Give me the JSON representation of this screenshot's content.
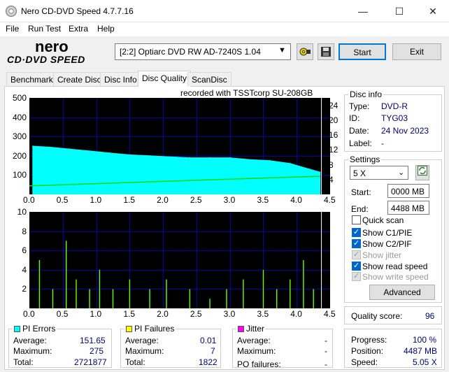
{
  "window": {
    "title": "Nero CD-DVD Speed 4.7.7.16",
    "min_symbol": "—",
    "max_symbol": "☐",
    "close_symbol": "✕"
  },
  "menu": [
    "File",
    "Run Test",
    "Extra",
    "Help"
  ],
  "toolbar": {
    "drive": "[2:2]  Optiarc DVD RW AD-7240S 1.04",
    "start_label": "Start",
    "exit_label": "Exit"
  },
  "logo": {
    "nero": "nero",
    "sub": "CD·DVD SPEED"
  },
  "tabs": [
    "Benchmark",
    "Create Disc",
    "Disc Info",
    "Disc Quality",
    "ScanDisc"
  ],
  "active_tab": "Disc Quality",
  "chart_top": {
    "recorded_with": "recorded with TSSTcorp SU-208GB",
    "y_left_ticks": [
      "500",
      "400",
      "300",
      "200",
      "100"
    ],
    "y_right_ticks": [
      "24",
      "20",
      "16",
      "12",
      "8",
      "4"
    ],
    "x_ticks": [
      "0.0",
      "0.5",
      "1.0",
      "1.5",
      "2.0",
      "2.5",
      "3.0",
      "3.5",
      "4.0",
      "4.5"
    ]
  },
  "chart_bottom": {
    "y_ticks": [
      "10",
      "8",
      "6",
      "4",
      "2"
    ],
    "x_ticks": [
      "0.0",
      "0.5",
      "1.0",
      "1.5",
      "2.0",
      "2.5",
      "3.0",
      "3.5",
      "4.0",
      "4.5"
    ]
  },
  "chart_data": [
    {
      "type": "area",
      "title": "recorded with TSSTcorp SU-208GB",
      "xlim": [
        0,
        4.5
      ],
      "ylim": [
        0,
        500
      ],
      "y2lim": [
        0,
        26
      ],
      "series": [
        {
          "name": "PI Errors",
          "color": "#00ffff",
          "x": [
            0.05,
            0.3,
            0.6,
            0.9,
            1.2,
            1.5,
            1.8,
            2.1,
            2.4,
            2.7,
            3.0,
            3.3,
            3.6,
            3.9,
            4.2,
            4.35
          ],
          "values": [
            250,
            245,
            235,
            225,
            215,
            205,
            200,
            195,
            190,
            190,
            190,
            180,
            175,
            160,
            130,
            115
          ]
        },
        {
          "name": "Read speed",
          "color": "#00dd00",
          "axis": "right",
          "x": [
            0.0,
            0.5,
            1.0,
            1.5,
            2.0,
            2.5,
            3.0,
            3.5,
            4.0,
            4.35
          ],
          "values": [
            2.3,
            2.6,
            2.9,
            3.2,
            3.5,
            3.8,
            4.1,
            4.4,
            4.7,
            4.9
          ]
        }
      ]
    },
    {
      "type": "bar",
      "xlim": [
        0,
        4.5
      ],
      "ylim": [
        0,
        10
      ],
      "series": [
        {
          "name": "PI Failures",
          "color": "#66ff00",
          "x": [
            0.15,
            0.35,
            0.55,
            0.7,
            0.9,
            1.05,
            1.25,
            1.5,
            1.8,
            2.05,
            2.4,
            2.7,
            2.95,
            3.2,
            3.5,
            3.7,
            3.9,
            4.1,
            4.25
          ],
          "values": [
            5,
            2,
            7,
            3,
            2,
            4,
            2,
            3,
            2,
            3,
            2,
            1,
            2,
            3,
            4,
            2,
            3,
            5,
            2
          ]
        }
      ]
    }
  ],
  "disc_info": {
    "title": "Disc info",
    "type_label": "Type:",
    "type_value": "DVD-R",
    "id_label": "ID:",
    "id_value": "TYG03",
    "date_label": "Date:",
    "date_value": "24 Nov 2023",
    "label_label": "Label:",
    "label_value": "-"
  },
  "settings": {
    "title": "Settings",
    "speed": "5 X",
    "start_label": "Start:",
    "start_value": "0000 MB",
    "end_label": "End:",
    "end_value": "4488 MB",
    "quick_scan": "Quick scan",
    "show_c1pie": "Show C1/PIE",
    "show_c2pif": "Show C2/PIF",
    "show_jitter": "Show jitter",
    "show_read_speed": "Show read speed",
    "show_write_speed": "Show write speed",
    "advanced": "Advanced"
  },
  "quality": {
    "label": "Quality score:",
    "value": "96"
  },
  "progress": {
    "progress_label": "Progress:",
    "progress_value": "100 %",
    "position_label": "Position:",
    "position_value": "4487 MB",
    "speed_label": "Speed:",
    "speed_value": "5.05 X"
  },
  "pi_errors": {
    "title": "PI Errors",
    "color": "#00ffff",
    "avg_label": "Average:",
    "avg": "151.65",
    "max_label": "Maximum:",
    "max": "275",
    "total_label": "Total:",
    "total": "2721877"
  },
  "pi_failures": {
    "title": "PI Failures",
    "color": "#ffff00",
    "avg_label": "Average:",
    "avg": "0.01",
    "max_label": "Maximum:",
    "max": "7",
    "total_label": "Total:",
    "total": "1822"
  },
  "jitter": {
    "title": "Jitter",
    "color": "#ff00ff",
    "avg_label": "Average:",
    "avg": "-",
    "max_label": "Maximum:",
    "max": "-",
    "po_label": "PO failures:",
    "po": "-"
  }
}
